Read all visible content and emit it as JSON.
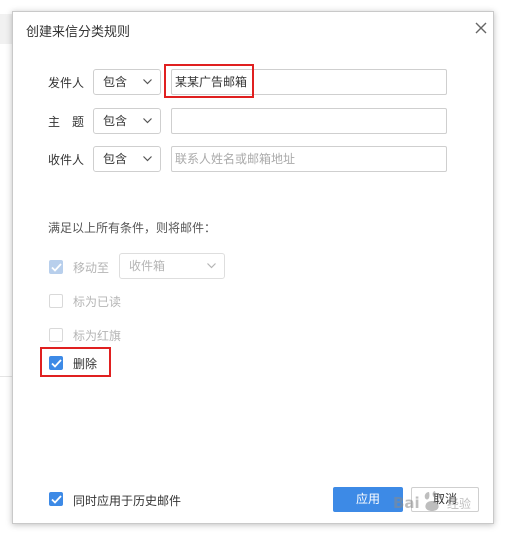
{
  "dialog": {
    "title": "创建来信分类规则"
  },
  "conditions": [
    {
      "label": "发件人",
      "operator": "包含",
      "value": "某某广告邮箱",
      "placeholder": ""
    },
    {
      "label": "主　题",
      "operator": "包含",
      "value": "",
      "placeholder": ""
    },
    {
      "label": "收件人",
      "operator": "包含",
      "value": "",
      "placeholder": "联系人姓名或邮箱地址"
    }
  ],
  "actions": {
    "section_label": "满足以上所有条件，则将邮件：",
    "move_to": {
      "label": "移动至",
      "checked": true,
      "disabled": true,
      "folder": "收件箱"
    },
    "mark_read": {
      "label": "标为已读",
      "checked": false,
      "disabled": true
    },
    "mark_flag": {
      "label": "标为红旗",
      "checked": false,
      "disabled": true
    },
    "delete": {
      "label": "删除",
      "checked": true,
      "disabled": false
    }
  },
  "footer": {
    "apply_history_label": "同时应用于历史邮件",
    "apply_history_checked": true,
    "apply_button": "应用",
    "cancel_button": "取消"
  },
  "colors": {
    "accent": "#3d8ae6",
    "highlight": "#e02020"
  },
  "watermark": {
    "text": "Bai百度经验"
  }
}
